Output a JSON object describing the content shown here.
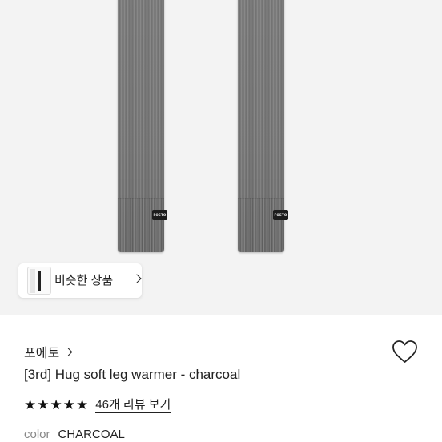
{
  "product_image": {
    "brand_tag_text": "FOETO",
    "product_color": "#777777"
  },
  "similar": {
    "label": "비슷한 상품",
    "icon": "chevron-right-icon"
  },
  "product": {
    "brand": "포에토",
    "brand_icon": "chevron-right-icon",
    "title": "[3rd] Hug soft leg warmer - charcoal",
    "wishlist_icon": "heart-icon",
    "rating": {
      "stars": [
        "★",
        "★",
        "★",
        "★",
        "★"
      ],
      "value": 5,
      "reviews_label": "46개 리뷰 보기"
    },
    "option": {
      "key": "color",
      "value": "CHARCOAL"
    }
  }
}
